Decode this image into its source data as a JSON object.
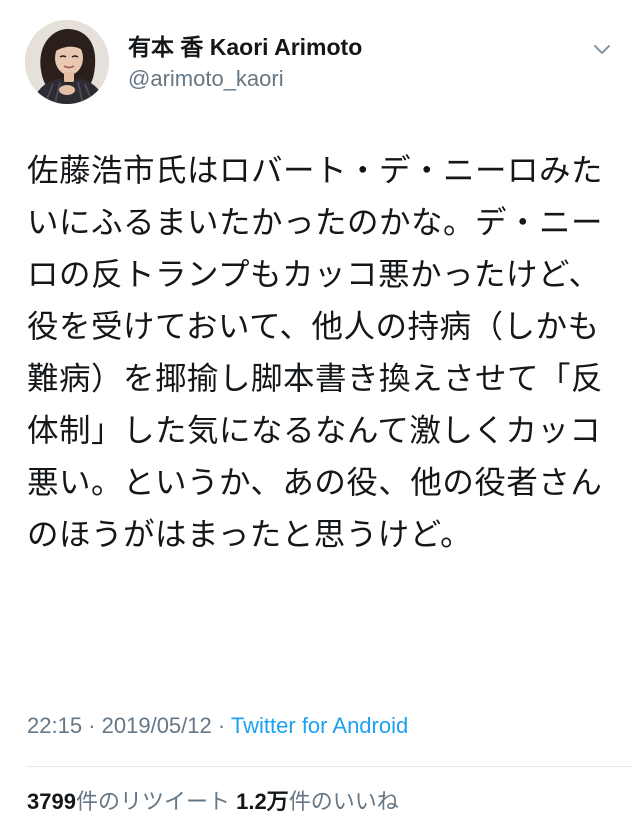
{
  "tweet": {
    "author": {
      "display_name": "有本 香 Kaori Arimoto",
      "handle": "@arimoto_kaori",
      "avatar_icon": "avatar"
    },
    "menu_icon": "chevron-down-icon",
    "text": "佐藤浩市氏はロバート・デ・ニーロみたいにふるまいたかったのかな。デ・ニーロの反トランプもカッコ悪かったけど、役を受けておいて、他人の持病（しかも難病）を揶揄し脚本書き換えさせて「反体制」した気になるなんて激しくカッコ悪い。というか、あの役、他の役者さんのほうがはまったと思うけど。",
    "time": "22:15",
    "separator": "·",
    "date": "2019/05/12",
    "source": "Twitter for Android",
    "stats": {
      "retweets_count": "3799",
      "retweets_label": "件のリツイート",
      "likes_count": "1.2万",
      "likes_label": "件のいいね"
    }
  },
  "colors": {
    "text": "#14171a",
    "secondary": "#657786",
    "link": "#1da1f2",
    "divider": "#e1e8ed"
  }
}
